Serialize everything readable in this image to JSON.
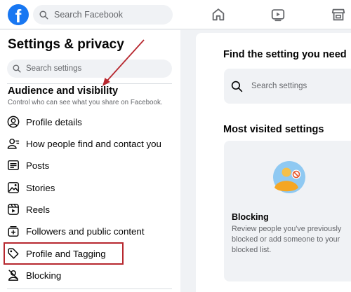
{
  "topbar": {
    "logo_letter": "f",
    "search_placeholder": "Search Facebook",
    "nav_icons": [
      "home-icon",
      "watch-icon",
      "marketplace-icon"
    ]
  },
  "sidebar": {
    "title": "Settings & privacy",
    "search_placeholder": "Search settings",
    "section_title": "Audience and visibility",
    "section_subtitle": "Control who can see what you share on Facebook.",
    "items": [
      {
        "label": "Profile details",
        "icon": "profile-details-icon"
      },
      {
        "label": "How people find and contact you",
        "icon": "find-contact-icon"
      },
      {
        "label": "Posts",
        "icon": "posts-icon"
      },
      {
        "label": "Stories",
        "icon": "stories-icon"
      },
      {
        "label": "Reels",
        "icon": "reels-icon"
      },
      {
        "label": "Followers and public content",
        "icon": "followers-icon"
      },
      {
        "label": "Profile and Tagging",
        "icon": "tag-icon",
        "highlighted": true
      },
      {
        "label": "Blocking",
        "icon": "blocking-icon"
      }
    ]
  },
  "main": {
    "find_title": "Find the setting you need",
    "search_placeholder": "Search settings",
    "visited_title": "Most visited settings",
    "card": {
      "title": "Blocking",
      "description": "Review people you've previously blocked or add someone to your blocked list."
    }
  },
  "colors": {
    "brand": "#1877f2",
    "annotation": "#b7282f",
    "background": "#f0f2f5"
  }
}
